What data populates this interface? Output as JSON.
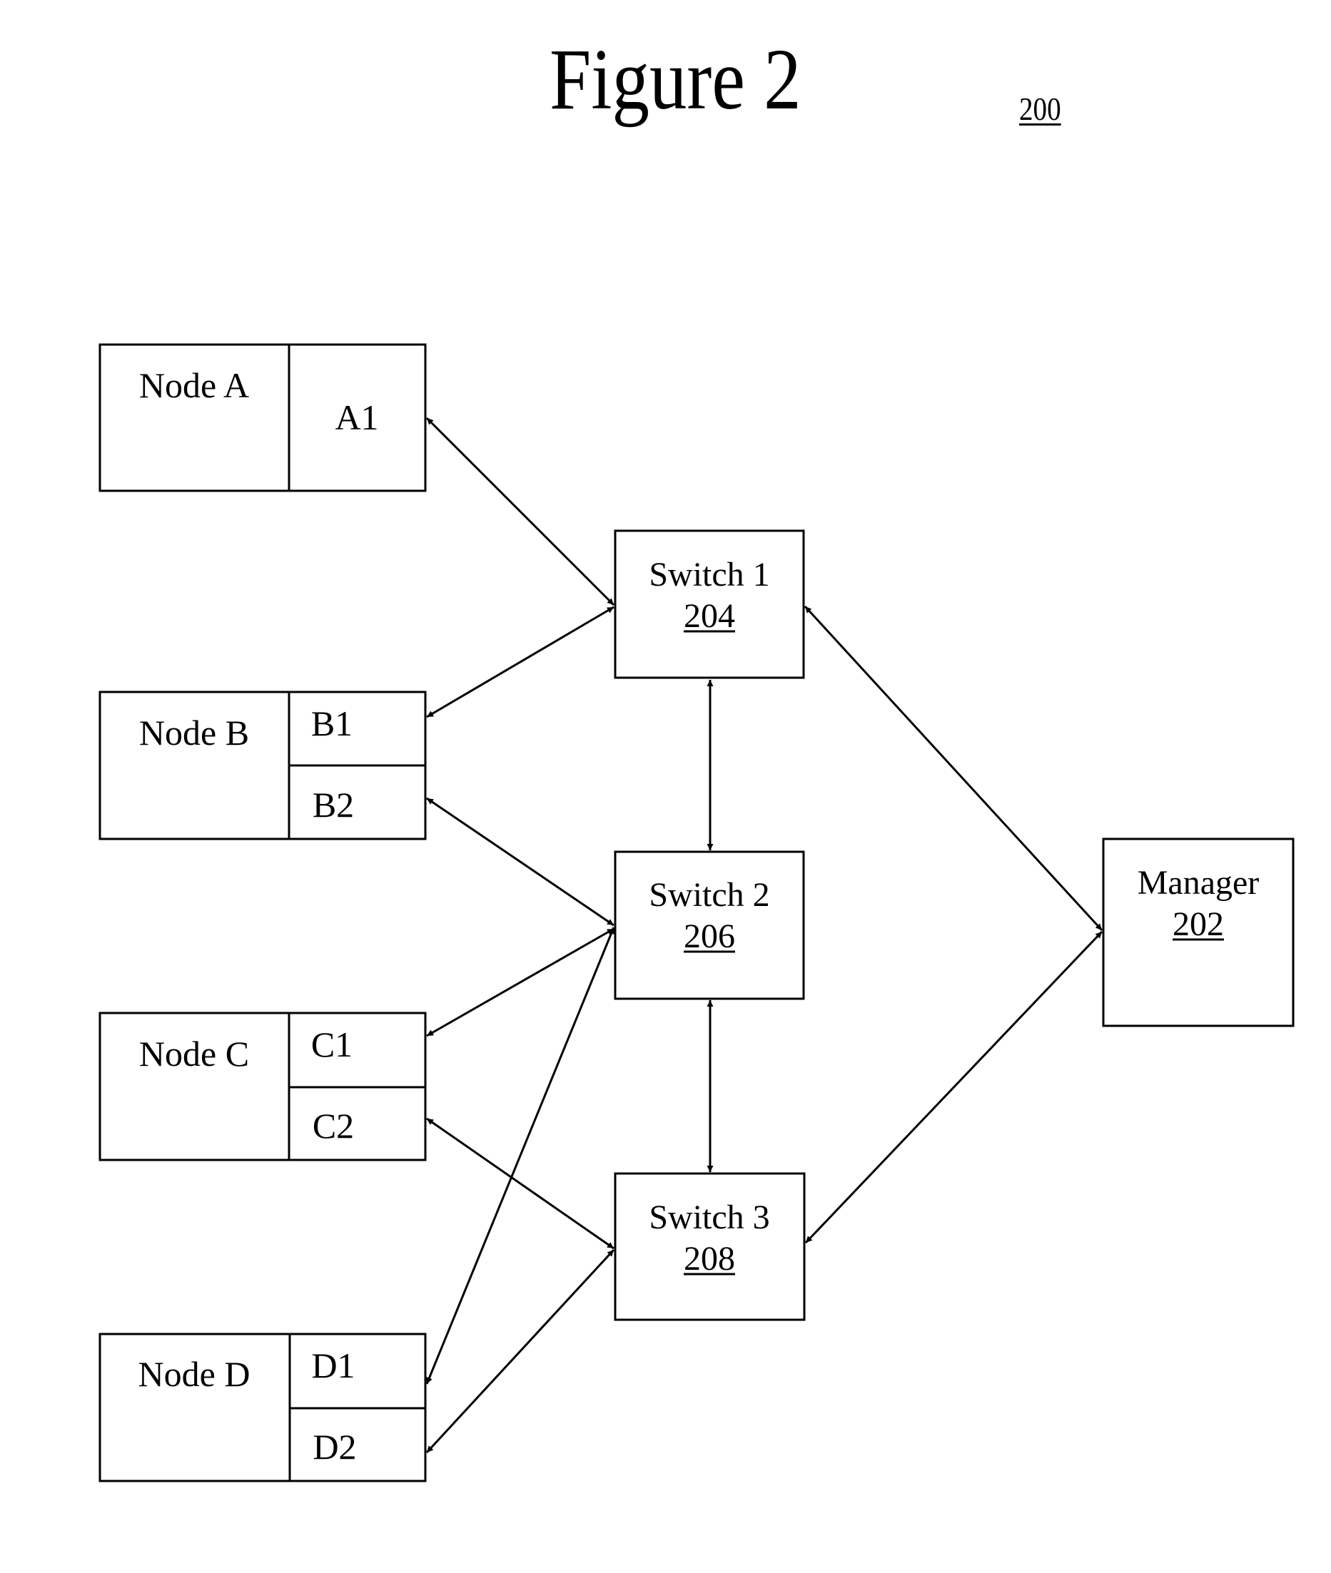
{
  "figure": {
    "title": "Figure 2",
    "reference_number": "200"
  },
  "nodes": [
    {
      "id": "A",
      "label": "Node A",
      "ports": [
        "A1"
      ]
    },
    {
      "id": "B",
      "label": "Node B",
      "ports": [
        "B1",
        "B2"
      ]
    },
    {
      "id": "C",
      "label": "Node C",
      "ports": [
        "C1",
        "C2"
      ]
    },
    {
      "id": "D",
      "label": "Node D",
      "ports": [
        "D1",
        "D2"
      ]
    }
  ],
  "switches": [
    {
      "id": "S1",
      "label": "Switch 1",
      "ref": "204"
    },
    {
      "id": "S2",
      "label": "Switch 2",
      "ref": "206"
    },
    {
      "id": "S3",
      "label": "Switch 3",
      "ref": "208"
    }
  ],
  "manager": {
    "id": "M",
    "label": "Manager",
    "ref": "202"
  },
  "connections": [
    {
      "from": "A1",
      "to": "Switch 1",
      "bidirectional": true
    },
    {
      "from": "B1",
      "to": "Switch 1",
      "bidirectional": true
    },
    {
      "from": "B2",
      "to": "Switch 2",
      "bidirectional": true
    },
    {
      "from": "C1",
      "to": "Switch 2",
      "bidirectional": true
    },
    {
      "from": "D1",
      "to": "Switch 2",
      "bidirectional": true
    },
    {
      "from": "C2",
      "to": "Switch 3",
      "bidirectional": true
    },
    {
      "from": "D2",
      "to": "Switch 3",
      "bidirectional": true
    },
    {
      "from": "Switch 1",
      "to": "Switch 2",
      "bidirectional": true
    },
    {
      "from": "Switch 2",
      "to": "Switch 3",
      "bidirectional": true
    },
    {
      "from": "Switch 1",
      "to": "Manager",
      "bidirectional": true
    },
    {
      "from": "Switch 3",
      "to": "Manager",
      "bidirectional": true
    }
  ]
}
